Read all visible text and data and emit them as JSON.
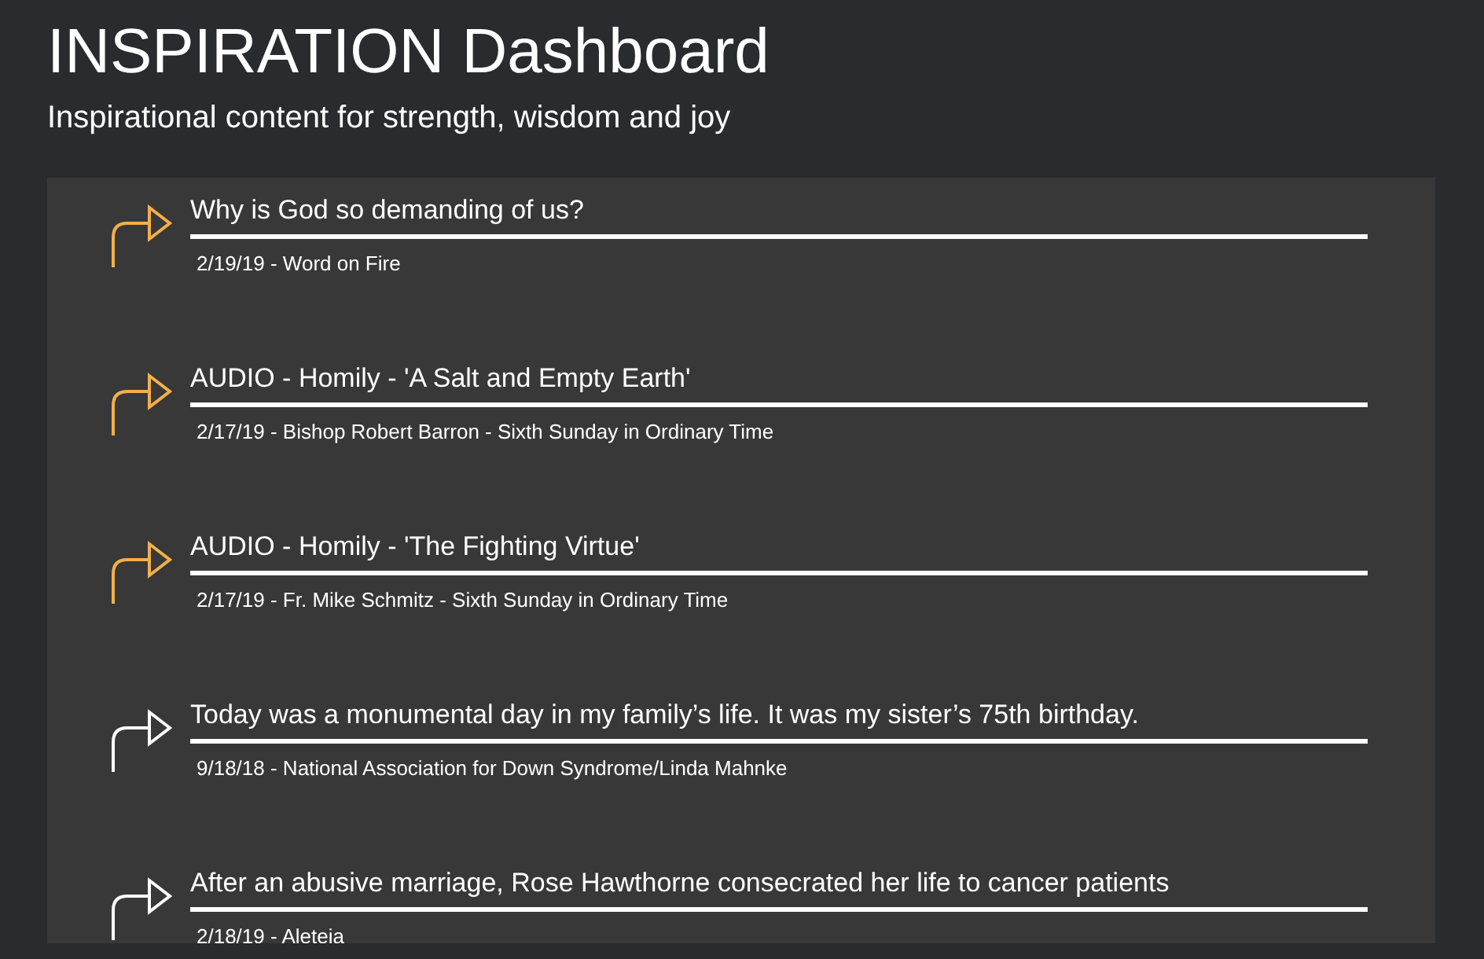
{
  "header": {
    "title": "INSPIRATION Dashboard",
    "subtitle": "Inspirational content for strength, wisdom and joy"
  },
  "items": [
    {
      "title": "Why is God so demanding of us?",
      "meta": "2/19/19 - Word on Fire",
      "color": "#f2b04a"
    },
    {
      "title": "AUDIO - Homily - 'A Salt and Empty Earth'",
      "meta": "2/17/19 - Bishop Robert Barron - Sixth Sunday in Ordinary Time",
      "color": "#f2b04a"
    },
    {
      "title": "AUDIO - Homily - 'The Fighting Virtue'",
      "meta": "2/17/19 - Fr. Mike Schmitz - Sixth Sunday in Ordinary Time",
      "color": "#f2b04a"
    },
    {
      "title": "Today was a monumental day in my family’s life. It was my sister’s 75th birthday.",
      "meta": "9/18/18 - National Association for Down Syndrome/Linda Mahnke",
      "color": "#ffffff"
    },
    {
      "title": "After an abusive marriage, Rose Hawthorne consecrated her life to cancer patients",
      "meta": "2/18/19 - Aleteia",
      "color": "#ffffff"
    }
  ]
}
